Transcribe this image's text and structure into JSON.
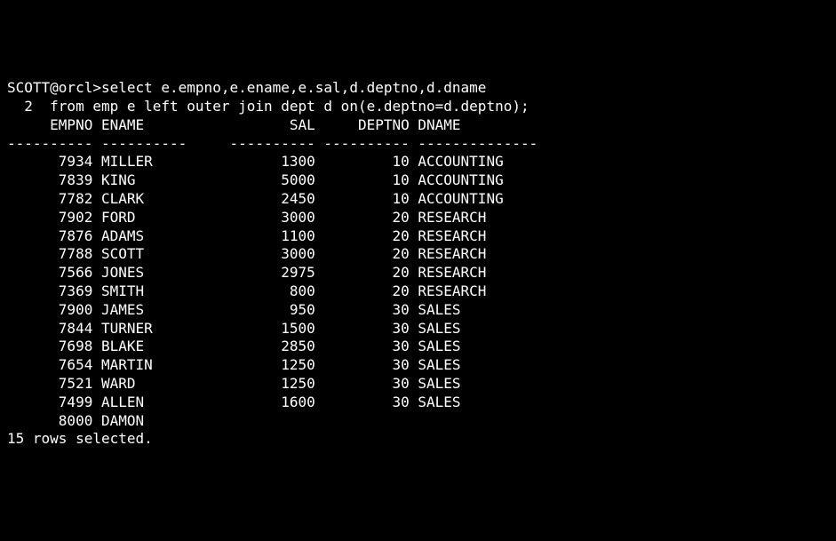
{
  "prompt": "SCOTT@orcl>",
  "sql_line1": "select e.empno,e.ename,e.sal,d.deptno,d.dname",
  "cont_prefix": "  2  ",
  "sql_line2": "from emp e left outer join dept d on(e.deptno=d.deptno);",
  "headers": {
    "empno": "EMPNO",
    "ename": "ENAME",
    "sal": "SAL",
    "deptno": "DEPTNO",
    "dname": "DNAME"
  },
  "chart_data": {
    "type": "table",
    "columns": [
      "EMPNO",
      "ENAME",
      "SAL",
      "DEPTNO",
      "DNAME"
    ],
    "rows": [
      {
        "empno": 7934,
        "ename": "MILLER",
        "sal": 1300,
        "deptno": 10,
        "dname": "ACCOUNTING"
      },
      {
        "empno": 7839,
        "ename": "KING",
        "sal": 5000,
        "deptno": 10,
        "dname": "ACCOUNTING"
      },
      {
        "empno": 7782,
        "ename": "CLARK",
        "sal": 2450,
        "deptno": 10,
        "dname": "ACCOUNTING"
      },
      {
        "empno": 7902,
        "ename": "FORD",
        "sal": 3000,
        "deptno": 20,
        "dname": "RESEARCH"
      },
      {
        "empno": 7876,
        "ename": "ADAMS",
        "sal": 1100,
        "deptno": 20,
        "dname": "RESEARCH"
      },
      {
        "empno": 7788,
        "ename": "SCOTT",
        "sal": 3000,
        "deptno": 20,
        "dname": "RESEARCH"
      },
      {
        "empno": 7566,
        "ename": "JONES",
        "sal": 2975,
        "deptno": 20,
        "dname": "RESEARCH"
      },
      {
        "empno": 7369,
        "ename": "SMITH",
        "sal": 800,
        "deptno": 20,
        "dname": "RESEARCH"
      },
      {
        "empno": 7900,
        "ename": "JAMES",
        "sal": 950,
        "deptno": 30,
        "dname": "SALES"
      },
      {
        "empno": 7844,
        "ename": "TURNER",
        "sal": 1500,
        "deptno": 30,
        "dname": "SALES"
      },
      {
        "empno": 7698,
        "ename": "BLAKE",
        "sal": 2850,
        "deptno": 30,
        "dname": "SALES"
      },
      {
        "empno": 7654,
        "ename": "MARTIN",
        "sal": 1250,
        "deptno": 30,
        "dname": "SALES"
      },
      {
        "empno": 7521,
        "ename": "WARD",
        "sal": 1250,
        "deptno": 30,
        "dname": "SALES"
      },
      {
        "empno": 7499,
        "ename": "ALLEN",
        "sal": 1600,
        "deptno": 30,
        "dname": "SALES"
      },
      {
        "empno": 8000,
        "ename": "DAMON",
        "sal": null,
        "deptno": null,
        "dname": null
      }
    ]
  },
  "footer": "15 rows selected.",
  "widths": {
    "empno": 10,
    "ename": 10,
    "sal_gap": 5,
    "sal": 10,
    "gap_after_sal": 1,
    "deptno": 10,
    "dname": 14
  }
}
